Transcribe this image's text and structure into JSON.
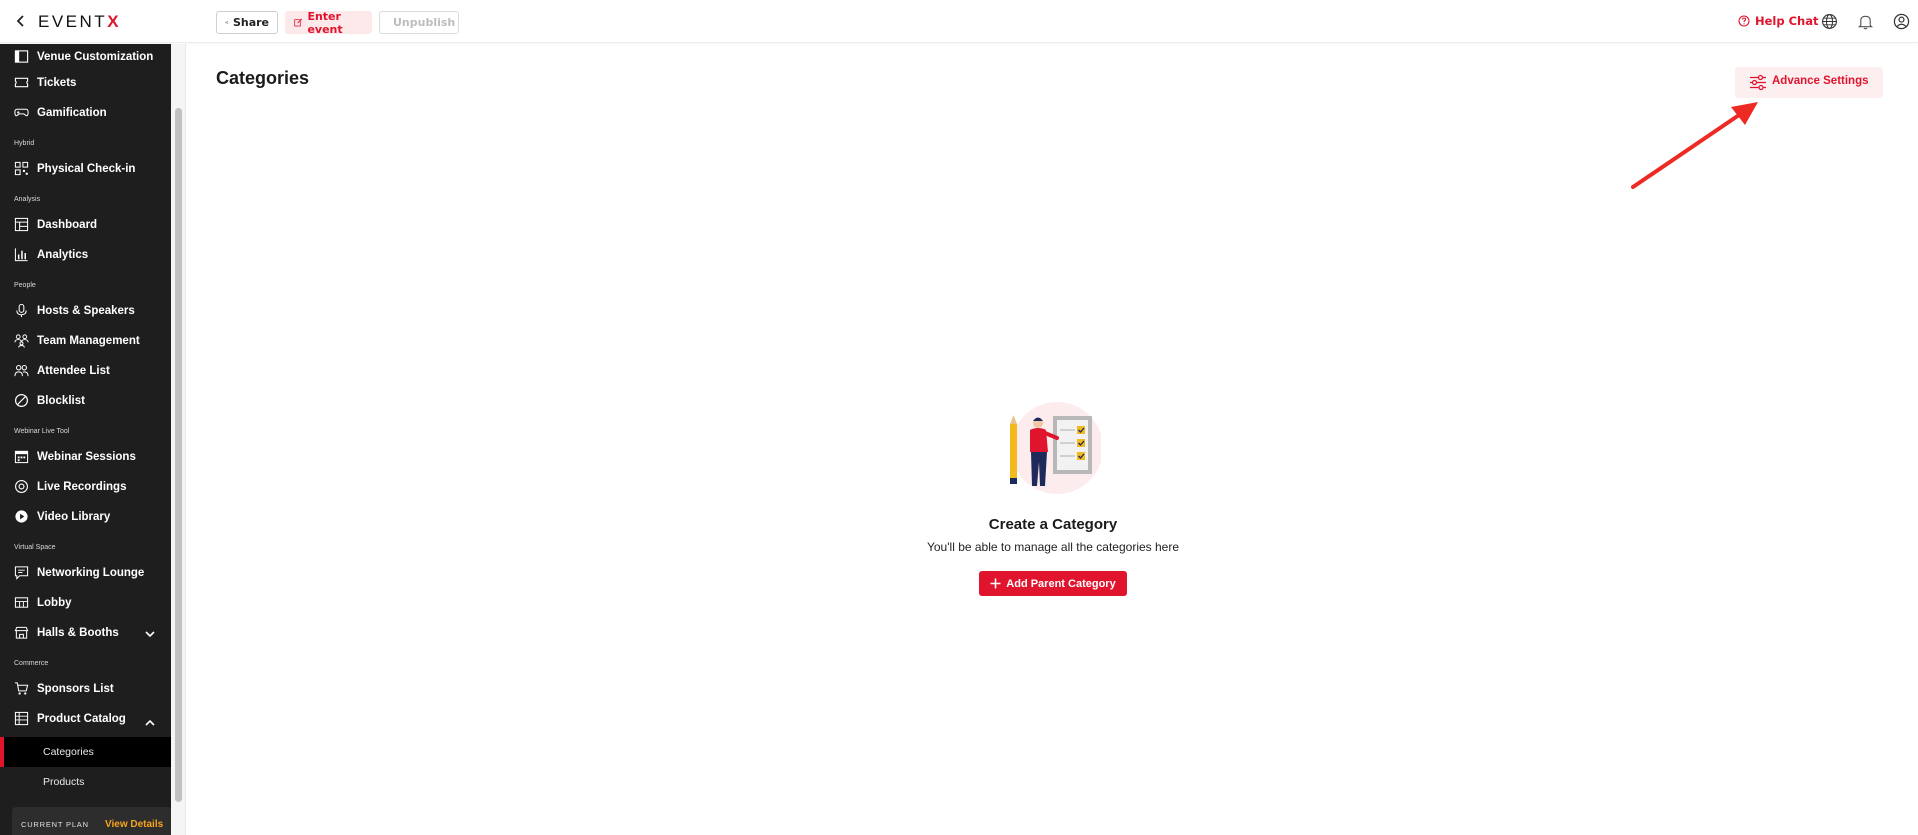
{
  "brand": {
    "logo_main": "EVENT",
    "logo_accent": "X",
    "accent_color": "#e0142d"
  },
  "topbar": {
    "share_label": "Share",
    "enter_label": "Enter event",
    "unpublish_label": "Unpublish",
    "help_label": "Help Chat",
    "icons": [
      "back-chevron-icon",
      "share-icon",
      "edit-icon",
      "unpublish-icon",
      "help-icon",
      "globe-icon",
      "bell-icon",
      "user-icon"
    ]
  },
  "sidebar": {
    "items": [
      {
        "label": "Venue Customization",
        "icon": "layout-icon"
      },
      {
        "label": "Tickets",
        "icon": "ticket-icon"
      },
      {
        "label": "Gamification",
        "icon": "gamepad-icon"
      },
      {
        "section": "Hybrid"
      },
      {
        "label": "Physical Check-in",
        "icon": "qr-icon"
      },
      {
        "section": "Analysis"
      },
      {
        "label": "Dashboard",
        "icon": "dashboard-icon"
      },
      {
        "label": "Analytics",
        "icon": "bar-chart-icon"
      },
      {
        "section": "People"
      },
      {
        "label": "Hosts & Speakers",
        "icon": "mic-icon"
      },
      {
        "label": "Team Management",
        "icon": "team-icon"
      },
      {
        "label": "Attendee List",
        "icon": "users-icon"
      },
      {
        "label": "Blocklist",
        "icon": "block-icon"
      },
      {
        "section": "Webinar Live Tool"
      },
      {
        "label": "Webinar Sessions",
        "icon": "calendar-icon"
      },
      {
        "label": "Live Recordings",
        "icon": "record-icon"
      },
      {
        "label": "Video Library",
        "icon": "video-icon"
      },
      {
        "section": "Virtual Space"
      },
      {
        "label": "Networking Lounge",
        "icon": "chat-icon"
      },
      {
        "label": "Lobby",
        "icon": "lobby-icon"
      },
      {
        "label": "Halls & Booths",
        "icon": "booth-icon",
        "expanded": false
      },
      {
        "section": "Commerce"
      },
      {
        "label": "Sponsors List",
        "icon": "sponsor-icon"
      },
      {
        "label": "Product Catalog",
        "icon": "catalog-icon",
        "expanded": true
      }
    ],
    "sub_items": [
      {
        "label": "Categories",
        "active": true
      },
      {
        "label": "Products",
        "active": false
      }
    ],
    "plan_label": "CURRENT PLAN",
    "plan_link": "View Details"
  },
  "main": {
    "title": "Categories",
    "advance_settings_label": "Advance Settings",
    "empty_title": "Create a Category",
    "empty_subtitle": "You'll be able to manage all the categories here",
    "add_button_label": "Add Parent Category"
  }
}
